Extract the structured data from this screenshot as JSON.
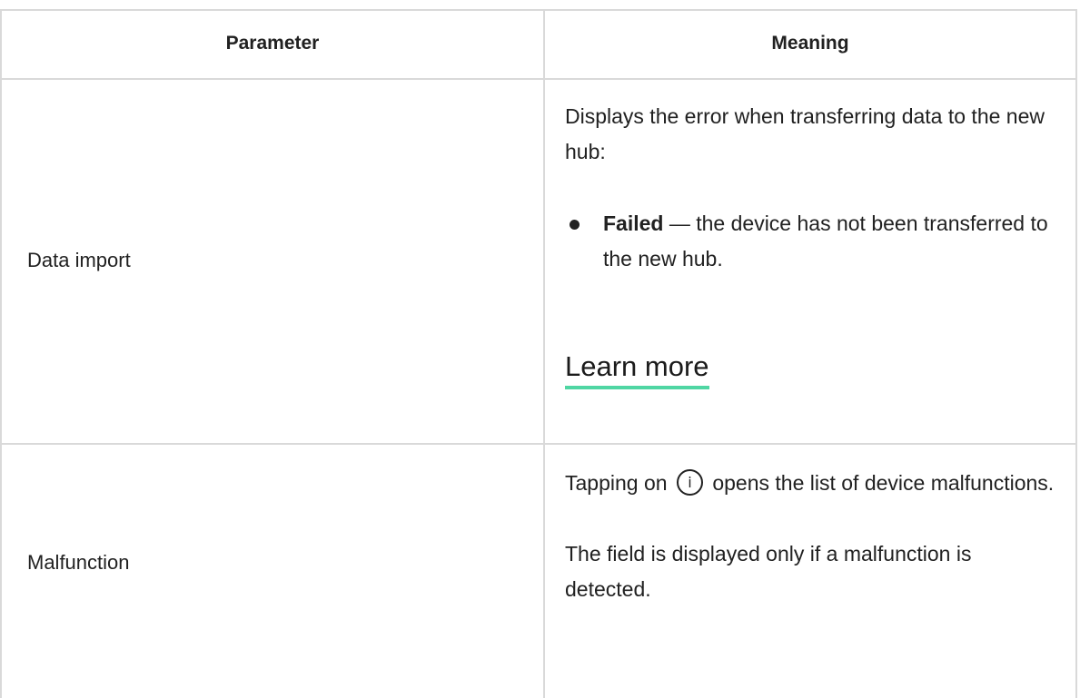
{
  "table": {
    "headers": {
      "parameter": "Parameter",
      "meaning": "Meaning"
    },
    "rows": [
      {
        "parameter": "Data import",
        "meaning_intro": "Displays the error when transferring data to the new hub:",
        "bullet_term": "Failed",
        "bullet_text": " — the device has not been transferred to the new hub.",
        "link_label": "Learn more"
      },
      {
        "parameter": "Malfunction",
        "meaning_before_icon": "Tapping on",
        "icon_glyph": "i",
        "meaning_after_icon": "opens the list of device malfunctions.",
        "meaning_note": "The field is displayed only if a malfunction is detected."
      }
    ]
  },
  "colors": {
    "border": "#d9d9d9",
    "link_underline": "#4fd6a3",
    "text": "#212121"
  }
}
